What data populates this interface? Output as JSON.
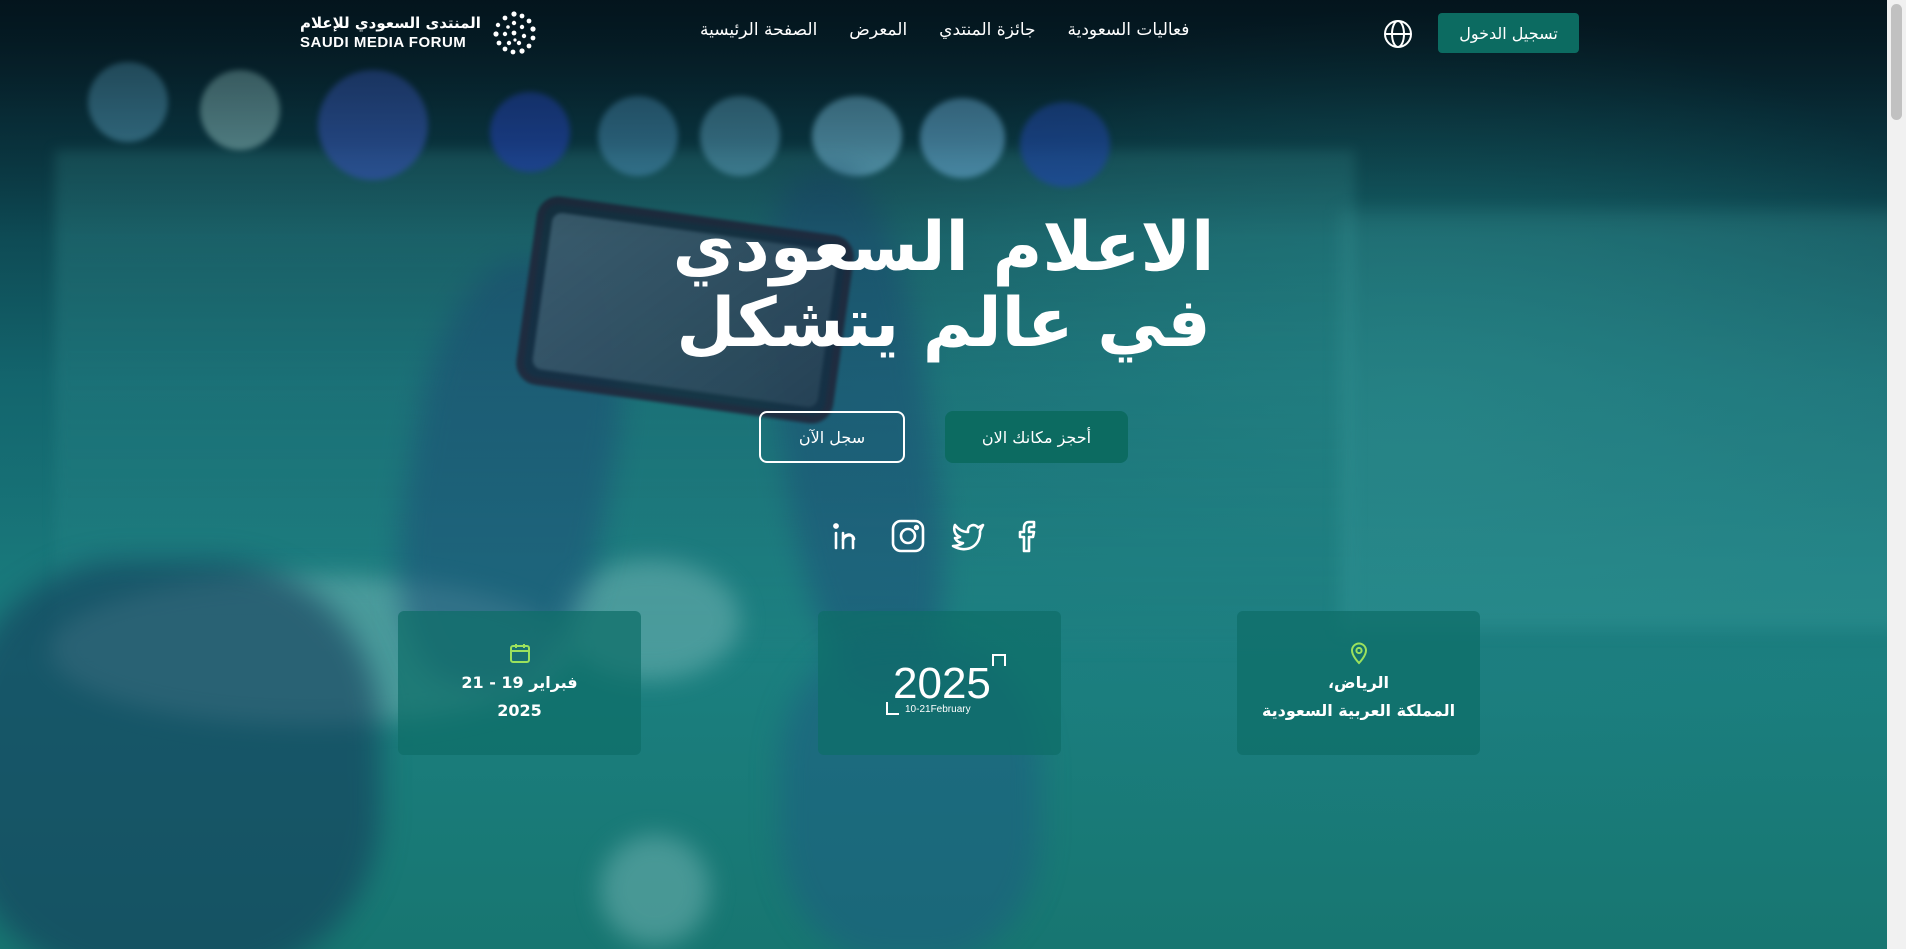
{
  "header": {
    "logo_ar": "المنتدى السعودي للإعلام",
    "logo_en": "SAUDI MEDIA FORUM",
    "nav": [
      {
        "label": "الصفحة الرئيسية"
      },
      {
        "label": "المعرض"
      },
      {
        "label": "جائزة المنتدي"
      },
      {
        "label": "فعاليات السعودية"
      }
    ],
    "login_label": "تسجيل الدخول"
  },
  "hero": {
    "title_line1": "الاعلام السعودي",
    "title_line2": "في عالم يتشكل",
    "register_label": "سجل الآن",
    "book_label": "أحجز مكانك الان"
  },
  "socials": [
    "linkedin-icon",
    "instagram-icon",
    "twitter-icon",
    "facebook-icon"
  ],
  "cards": {
    "date_line1": "فبراير 19 - 21",
    "date_line2": "2025",
    "badge_year": "2025",
    "badge_dates": "10-21February",
    "location_line1": "الرياض،",
    "location_line2": "المملكة العربية السعودية"
  },
  "colors": {
    "accent": "#0c6b61",
    "icon_green": "#9be15d",
    "card_bg": "#0e6e68"
  }
}
